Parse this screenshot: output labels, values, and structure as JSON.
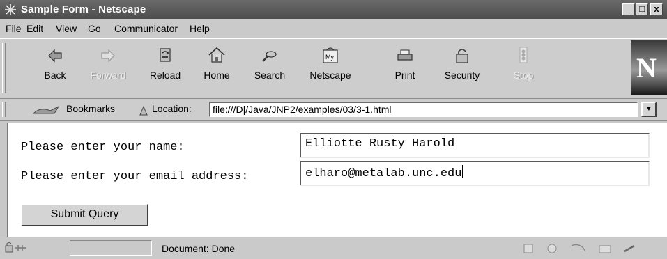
{
  "window": {
    "title": "Sample Form - Netscape",
    "controls": {
      "minimize": "_",
      "maximize": "□",
      "close": "x"
    }
  },
  "menu": [
    {
      "underline": "F",
      "rest": "ile"
    },
    {
      "underline": "E",
      "rest": "dit"
    },
    {
      "underline": "V",
      "rest": "iew"
    },
    {
      "underline": "G",
      "rest": "o"
    },
    {
      "underline": "C",
      "rest": "ommunicator"
    },
    {
      "underline": "H",
      "rest": "elp"
    }
  ],
  "toolbar": {
    "back": "Back",
    "forward": "Forward",
    "reload": "Reload",
    "home": "Home",
    "search": "Search",
    "netscape": "Netscape",
    "print": "Print",
    "security": "Security",
    "stop": "Stop",
    "my_label": "My",
    "logo_letter": "N"
  },
  "location_bar": {
    "bookmarks_label": "Bookmarks",
    "location_label": "Location:",
    "url": "file:///D|/Java/JNP2/examples/03/3-1.html"
  },
  "form": {
    "name_label": "Please enter your name:",
    "name_value": "Elliotte Rusty Harold",
    "email_label": "Please enter your email address:",
    "email_value": "elharo@metalab.unc.edu",
    "submit_label": "Submit Query"
  },
  "status": {
    "text": "Document: Done"
  },
  "icons": {
    "title": "netscape-app-icon",
    "back": "back-arrow-icon",
    "forward": "forward-arrow-icon",
    "reload": "reload-icon",
    "home": "home-icon",
    "search": "search-icon",
    "netscape": "my-netscape-icon",
    "print": "printer-icon",
    "security": "padlock-icon",
    "stop": "stop-icon"
  },
  "colors": {
    "titlebar": "#595959",
    "chrome": "#cacaca",
    "content_bg": "#ffffff"
  }
}
